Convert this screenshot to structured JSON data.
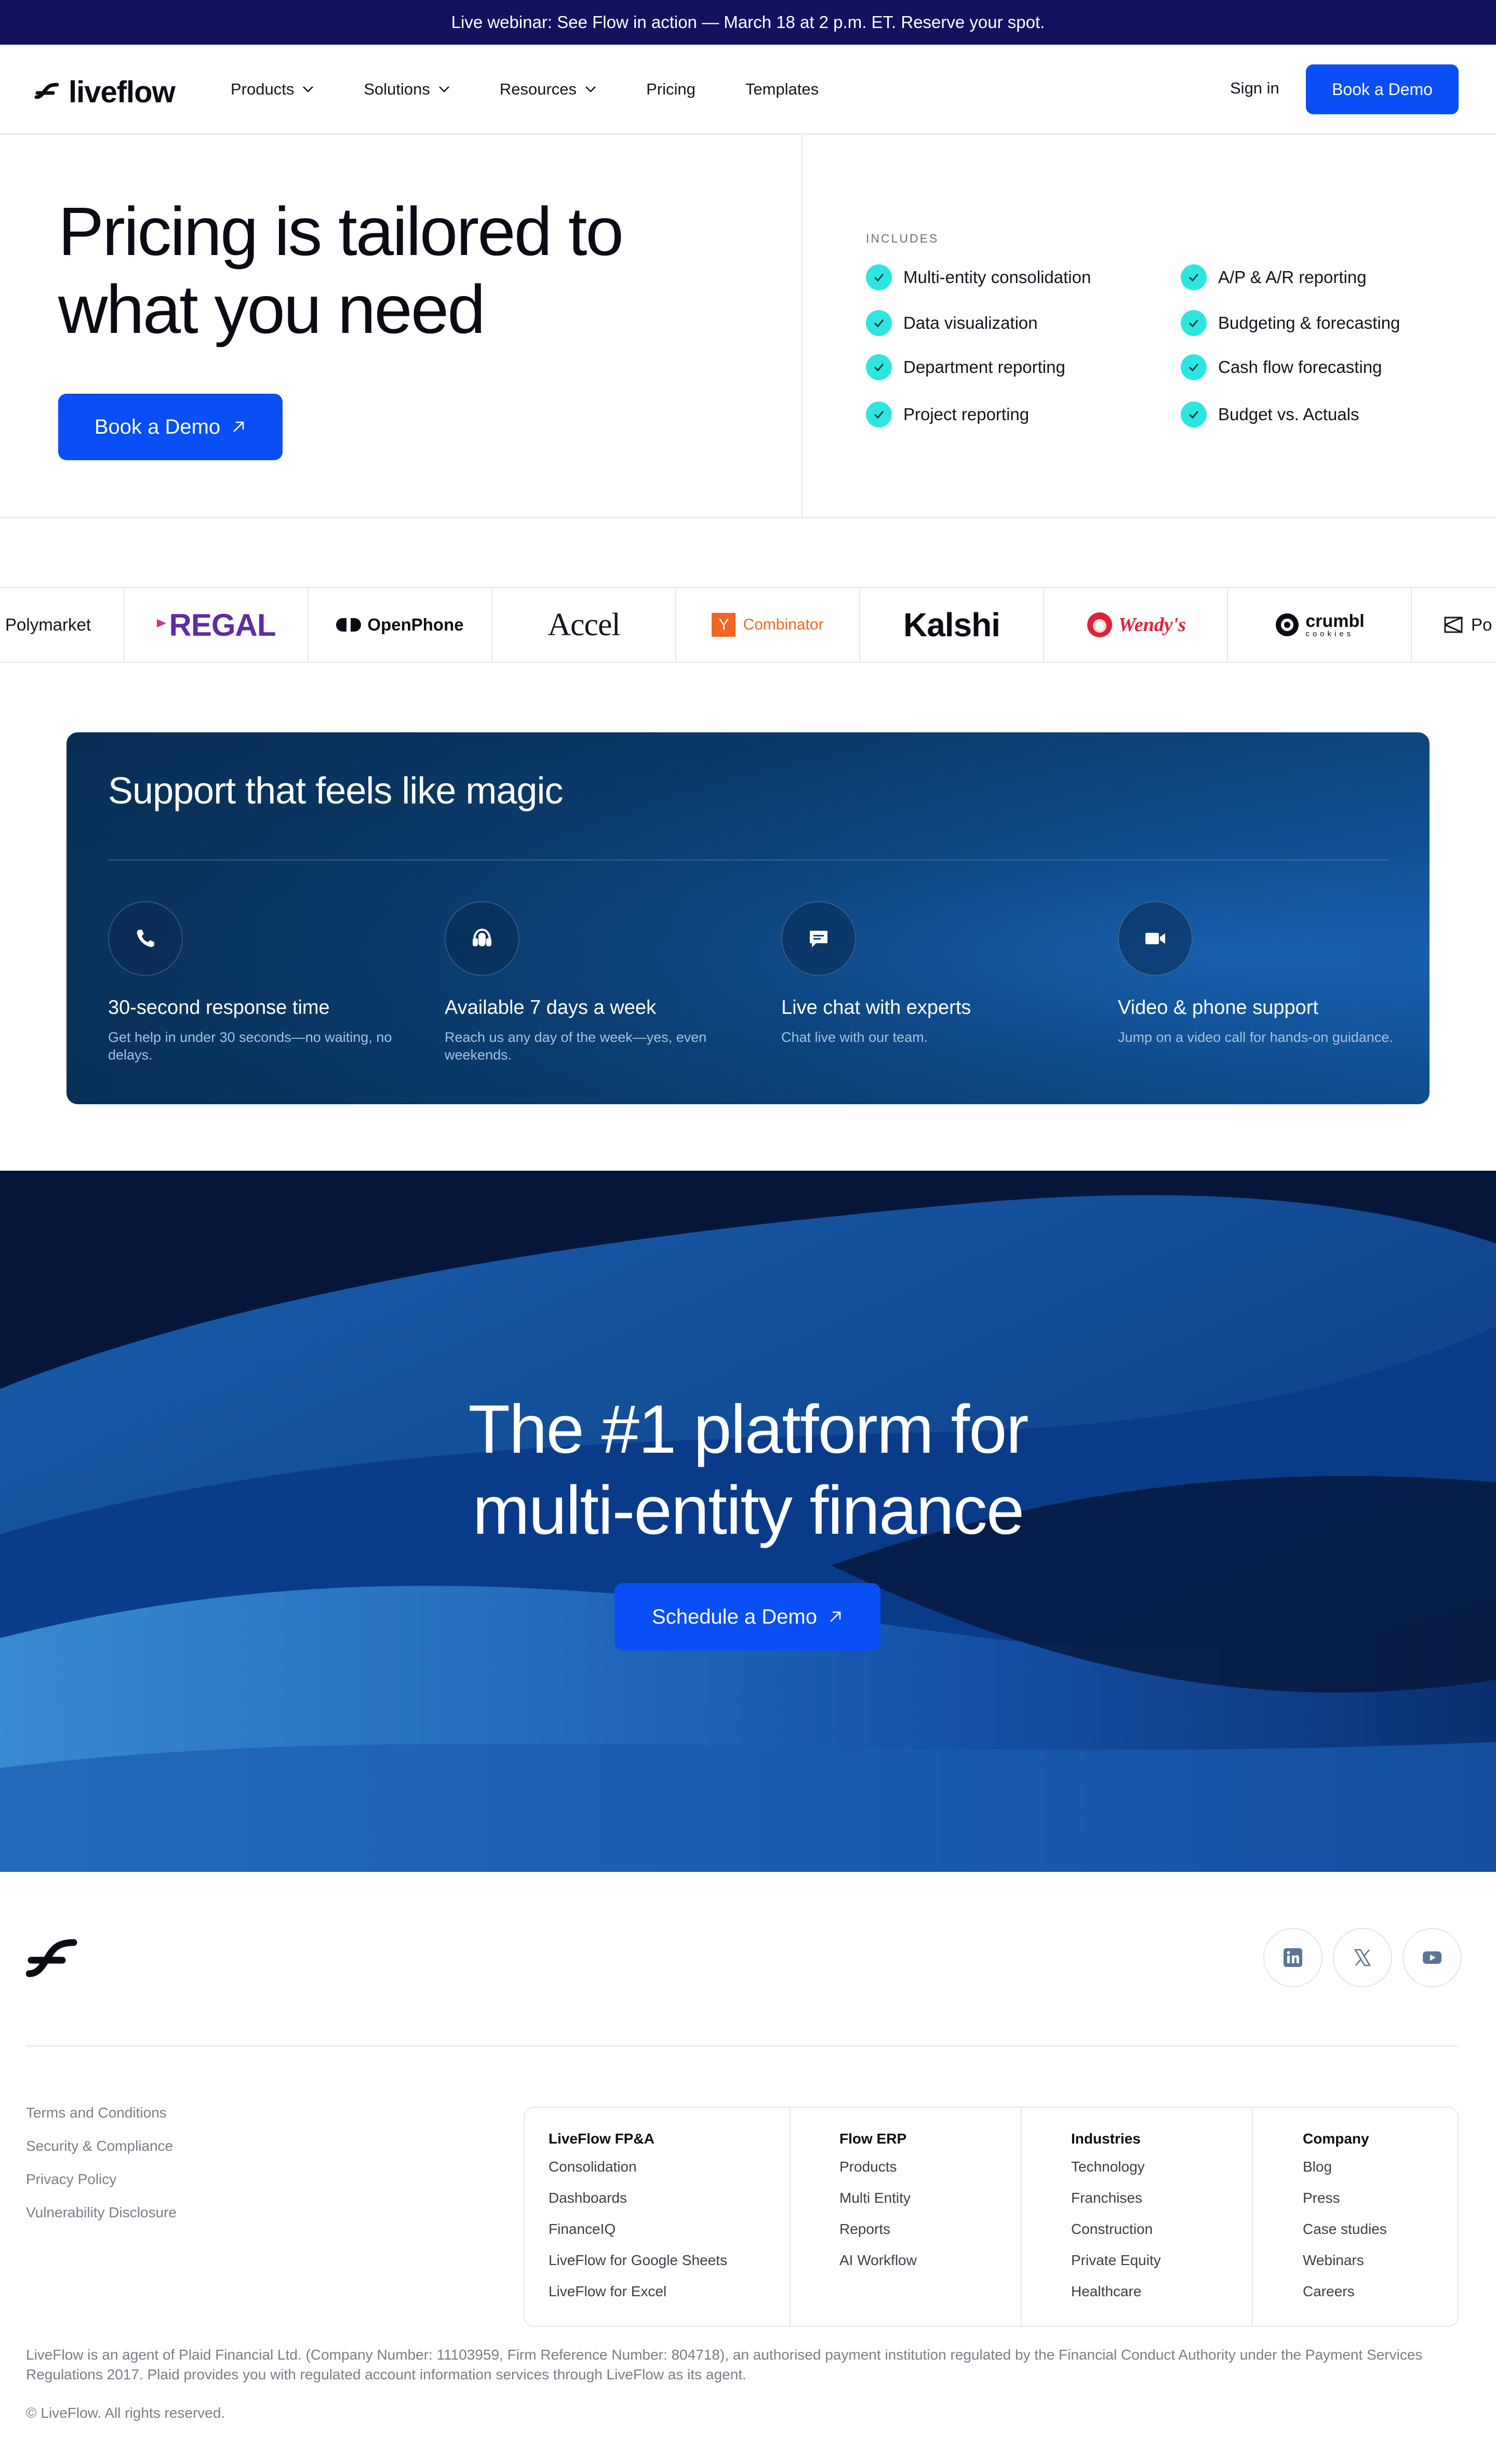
{
  "announcement": {
    "text": "Live webinar: See Flow in action — March 18 at 2 p.m. ET. Reserve your spot."
  },
  "nav": {
    "brand": "liveflow",
    "links": [
      {
        "label": "Products",
        "has_dropdown": true
      },
      {
        "label": "Solutions",
        "has_dropdown": true
      },
      {
        "label": "Resources",
        "has_dropdown": true
      },
      {
        "label": "Pricing",
        "has_dropdown": false
      },
      {
        "label": "Templates",
        "has_dropdown": false
      }
    ],
    "sign_in": "Sign in",
    "cta": "Book a Demo"
  },
  "hero": {
    "title": "Pricing is tailored to what you need",
    "cta": "Book a Demo",
    "includes_label": "INCLUDES",
    "features": [
      "Multi-entity consolidation",
      "A/P & A/R reporting",
      "Data visualization",
      "Budgeting & forecasting",
      "Department reporting",
      "Cash flow forecasting",
      "Project reporting",
      "Budget vs. Actuals"
    ]
  },
  "logos": {
    "items": [
      "Polymarket",
      "REGAL",
      "OpenPhone",
      "Accel",
      "Combinator",
      "Kalshi",
      "Wendy's",
      "crumbl",
      "cookies",
      "Po"
    ]
  },
  "support": {
    "title": "Support that feels like magic",
    "items": [
      {
        "icon": "phone-icon",
        "title": "30-second response time",
        "desc": "Get help in under 30 seconds—no waiting, no delays."
      },
      {
        "icon": "headset-icon",
        "title": "Available 7 days a week",
        "desc": "Reach us any day of the week—yes, even weekends."
      },
      {
        "icon": "chat-icon",
        "title": "Live chat with experts",
        "desc": "Chat live with our team."
      },
      {
        "icon": "video-icon",
        "title": "Video & phone support",
        "desc": "Jump on a video call for hands-on guidance."
      }
    ]
  },
  "cta_section": {
    "title_line1": "The #1 platform for",
    "title_line2": "multi-entity finance",
    "button": "Schedule a Demo"
  },
  "footer": {
    "social": [
      "linkedin-icon",
      "x-icon",
      "youtube-icon"
    ],
    "legal_links": [
      "Terms and Conditions",
      "Security & Compliance",
      "Privacy Policy",
      "Vulnerability Disclosure"
    ],
    "columns": [
      {
        "heading": "LiveFlow FP&A",
        "links": [
          "Consolidation",
          "Dashboards",
          "FinanceIQ",
          "LiveFlow for Google Sheets",
          "LiveFlow for Excel"
        ]
      },
      {
        "heading": "Flow ERP",
        "links": [
          "Products",
          "Multi Entity",
          "Reports",
          "AI Workflow"
        ]
      },
      {
        "heading": "Industries",
        "links": [
          "Technology",
          "Franchises",
          "Construction",
          "Private Equity",
          "Healthcare"
        ]
      },
      {
        "heading": "Company",
        "links": [
          "Blog",
          "Press",
          "Case studies",
          "Webinars",
          "Careers"
        ]
      }
    ],
    "disclaimer": "LiveFlow  is an agent of Plaid Financial Ltd. (Company Number: 11103959, Firm Reference Number: 804718), an authorised payment institution regulated by the Financial Conduct Authority under the Payment Services Regulations 2017. Plaid provides you with regulated account information services through LiveFlow as its agent.",
    "copyright": "© LiveFlow. All rights reserved."
  },
  "colors": {
    "announcement_bg": "#13125e",
    "primary_button": "#0a4ff5",
    "check_accent": "#2ee6e0",
    "support_card": "#0f4c8e",
    "cta_bg": "#071a44"
  }
}
